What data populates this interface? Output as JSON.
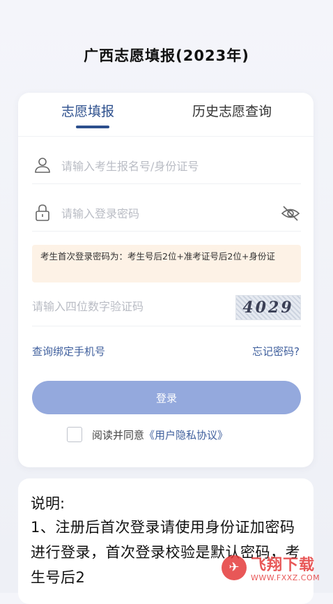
{
  "page_title": "广西志愿填报(2023年)",
  "tabs": [
    {
      "label": "志愿填报",
      "active": true
    },
    {
      "label": "历史志愿查询",
      "active": false
    }
  ],
  "login_form": {
    "username_placeholder": "请输入考生报名号/身份证号",
    "password_placeholder": "请输入登录密码",
    "notice": "考生首次登录密码为：考生号后2位+准考证号后2位+身份证",
    "captcha_placeholder": "请输入四位数字验证码",
    "captcha_code": "4029",
    "bind_phone_link": "查询绑定手机号",
    "forgot_password_link": "忘记密码?",
    "login_button": "登录",
    "agree_text": "阅读并同意",
    "privacy_link": "《用户隐私协议》",
    "agree_checked": false
  },
  "notes": {
    "title": "说明:",
    "body": "1、注册后首次登录请使用身份证加密码进行登录，首次登录校验是默认密码，考生号后2"
  },
  "watermark": {
    "name": "飞翔下载",
    "url": "WWW.FXXZ.COM"
  },
  "colors": {
    "accent": "#2c4f8d",
    "link": "#3f5f9d",
    "button": "#94a9dd",
    "notice_bg": "#fdf2e6"
  },
  "icons": [
    "user-icon",
    "lock-icon",
    "eye-off-icon"
  ]
}
